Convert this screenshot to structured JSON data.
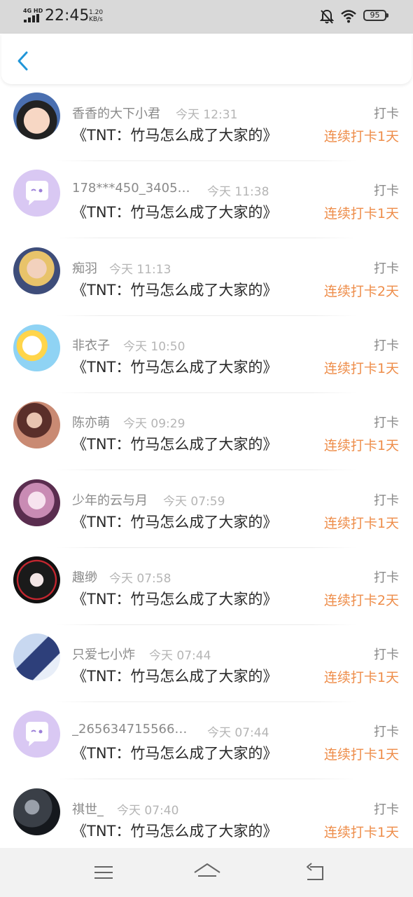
{
  "status_bar": {
    "network": "4G HD",
    "time": "22:45",
    "speed_value": "1.20",
    "speed_unit": "KB/s",
    "battery": "95"
  },
  "app_bar": {
    "back_icon": "chevron-left-icon"
  },
  "colors": {
    "accent": "#2196d8",
    "streak": "#ee8d4a",
    "primary_text": "#2a2a2a",
    "secondary_text": "#8a8a8a",
    "muted_text": "#b5b5b5"
  },
  "checkins": [
    {
      "name": "香香的大下小君",
      "time": "今天 12:31",
      "title": "《TNT：竹马怎么成了大家的》",
      "tag": "打卡",
      "streak": "连续打卡1天",
      "avatar": "boy-photo"
    },
    {
      "name": "178***450_3405…",
      "time": "今天 11:38",
      "title": "《TNT：竹马怎么成了大家的》",
      "tag": "打卡",
      "streak": "连续打卡1天",
      "avatar": "default-chat-bubble"
    },
    {
      "name": "痴羽",
      "time": "今天 11:13",
      "title": "《TNT：竹马怎么成了大家的》",
      "tag": "打卡",
      "streak": "连续打卡2天",
      "avatar": "girl-photo"
    },
    {
      "name": "非衣子",
      "time": "今天 10:50",
      "title": "《TNT：竹马怎么成了大家的》",
      "tag": "打卡",
      "streak": "连续打卡1天",
      "avatar": "cartoon-character"
    },
    {
      "name": "陈亦萌",
      "time": "今天 09:29",
      "title": "《TNT：竹马怎么成了大家的》",
      "tag": "打卡",
      "streak": "连续打卡1天",
      "avatar": "illustration-girl"
    },
    {
      "name": "少年的云与月",
      "time": "今天 07:59",
      "title": "《TNT：竹马怎么成了大家的》",
      "tag": "打卡",
      "streak": "连续打卡1天",
      "avatar": "anime-pink"
    },
    {
      "name": "趣缈",
      "time": "今天 07:58",
      "title": "《TNT：竹马怎么成了大家的》",
      "tag": "打卡",
      "streak": "连续打卡2天",
      "avatar": "anime-dark"
    },
    {
      "name": "只爱七小炸",
      "time": "今天 07:44",
      "title": "《TNT：竹马怎么成了大家的》",
      "tag": "打卡",
      "streak": "连续打卡1天",
      "avatar": "group-photo"
    },
    {
      "name": "_265634715566…",
      "time": "今天 07:44",
      "title": "《TNT：竹马怎么成了大家的》",
      "tag": "打卡",
      "streak": "连续打卡1天",
      "avatar": "default-chat-bubble"
    },
    {
      "name": "祺世_",
      "time": "今天 07:40",
      "title": "《TNT：竹马怎么成了大家的》",
      "tag": "打卡",
      "streak": "连续打卡1天",
      "avatar": "dark-photo"
    }
  ],
  "nav_bar": {
    "menu_icon": "menu-icon",
    "home_icon": "home-icon",
    "back_icon": "back-arrow-icon"
  }
}
